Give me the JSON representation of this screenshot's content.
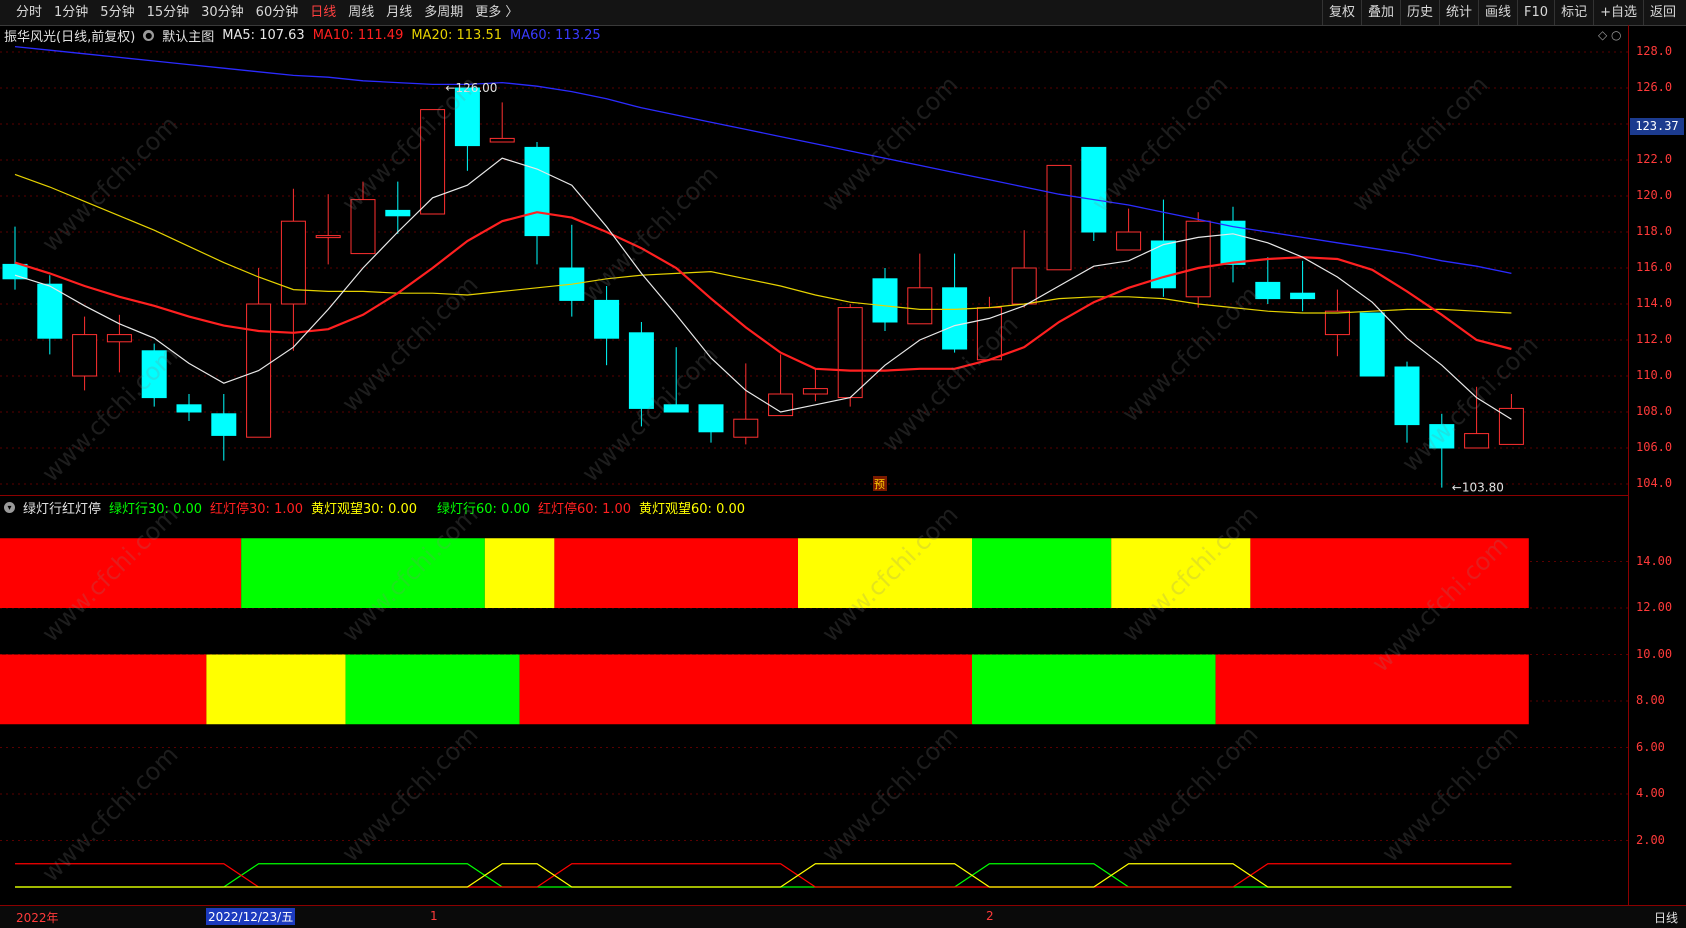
{
  "toolbar": {
    "periods": [
      "分时",
      "1分钟",
      "5分钟",
      "15分钟",
      "30分钟",
      "60分钟",
      "日线",
      "周线",
      "月线",
      "多周期",
      "更多 〉"
    ],
    "active_period": "日线",
    "right_tools": [
      "复权",
      "叠加",
      "历史",
      "统计",
      "画线",
      "F10",
      "标记",
      "+自选",
      "返回"
    ]
  },
  "main_info": {
    "stock": "振华风光(日线,前复权)",
    "template": "默认主图",
    "ma5": "MA5: 107.63",
    "ma10": "MA10: 111.49",
    "ma20": "MA20: 113.51",
    "ma60": "MA60: 113.25"
  },
  "sub_info": {
    "name": "绿灯行红灯停",
    "green30": "绿灯行30: 0.00",
    "red30": "红灯停30: 1.00",
    "yellow30": "黄灯观望30: 0.00",
    "green60": "绿灯行60: 0.00",
    "red60": "红灯停60: 1.00",
    "yellow60": "黄灯观望60: 0.00"
  },
  "annotations": {
    "high": "126.00",
    "low": "103.80",
    "forecast_mark": "预",
    "current_price": "123.37"
  },
  "price_axis": [
    "128.0",
    "126.0",
    "124.0",
    "122.0",
    "120.0",
    "118.0",
    "116.0",
    "114.0",
    "112.0",
    "110.0",
    "108.0",
    "106.0",
    "104.0"
  ],
  "sub_axis": [
    "14.00",
    "12.00",
    "10.00",
    "8.00",
    "6.00",
    "4.00",
    "2.00"
  ],
  "bottom": {
    "year": "2022年",
    "selected_date": "2022/12/23/五",
    "month1": "1",
    "month2": "2",
    "period": "日线"
  },
  "watermark": "www.cfchi.com",
  "colors": {
    "up": "#ff3030",
    "down": "#00ffff",
    "ma5": "#e8e8e8",
    "ma10": "#ff2020",
    "ma20": "#e6d200",
    "ma60": "#2b2bff",
    "signal_red": "#ff0000",
    "signal_green": "#00ff00",
    "signal_yellow": "#ffff00"
  },
  "chart_data": {
    "type": "candlestick",
    "y_range": [
      103.5,
      128.5
    ],
    "candles": [
      {
        "o": 116.2,
        "h": 118.3,
        "l": 114.8,
        "c": 115.4
      },
      {
        "o": 115.1,
        "h": 115.6,
        "l": 111.2,
        "c": 112.1
      },
      {
        "o": 110.0,
        "h": 113.3,
        "l": 109.2,
        "c": 112.3
      },
      {
        "o": 111.9,
        "h": 113.4,
        "l": 110.2,
        "c": 112.3
      },
      {
        "o": 111.4,
        "h": 111.8,
        "l": 108.3,
        "c": 108.8
      },
      {
        "o": 108.4,
        "h": 109.0,
        "l": 107.5,
        "c": 108.0
      },
      {
        "o": 107.9,
        "h": 109.0,
        "l": 105.3,
        "c": 106.7
      },
      {
        "o": 106.6,
        "h": 116.0,
        "l": 106.6,
        "c": 114.0
      },
      {
        "o": 114.0,
        "h": 120.4,
        "l": 111.4,
        "c": 118.6
      },
      {
        "o": 117.8,
        "h": 120.1,
        "l": 116.2,
        "c": 117.8
      },
      {
        "o": 116.8,
        "h": 120.8,
        "l": 116.8,
        "c": 119.8
      },
      {
        "o": 119.2,
        "h": 120.8,
        "l": 117.9,
        "c": 118.9
      },
      {
        "o": 119.0,
        "h": 122.0,
        "l": 119.0,
        "c": 124.8
      },
      {
        "o": 126.0,
        "h": 126.0,
        "l": 121.4,
        "c": 122.8
      },
      {
        "o": 123.0,
        "h": 125.2,
        "l": 123.0,
        "c": 123.2
      },
      {
        "o": 122.7,
        "h": 123.0,
        "l": 116.2,
        "c": 117.8
      },
      {
        "o": 116.0,
        "h": 118.4,
        "l": 113.3,
        "c": 114.2
      },
      {
        "o": 114.2,
        "h": 115.0,
        "l": 110.6,
        "c": 112.1
      },
      {
        "o": 112.4,
        "h": 113.0,
        "l": 107.2,
        "c": 108.2
      },
      {
        "o": 108.4,
        "h": 111.6,
        "l": 108.0,
        "c": 108.0
      },
      {
        "o": 108.4,
        "h": 108.4,
        "l": 106.3,
        "c": 106.9
      },
      {
        "o": 106.6,
        "h": 110.7,
        "l": 106.2,
        "c": 107.6
      },
      {
        "o": 107.8,
        "h": 111.2,
        "l": 107.8,
        "c": 109.0
      },
      {
        "o": 109.0,
        "h": 110.4,
        "l": 108.6,
        "c": 109.3
      },
      {
        "o": 108.8,
        "h": 114.0,
        "l": 108.3,
        "c": 113.8
      },
      {
        "o": 115.4,
        "h": 116.0,
        "l": 112.5,
        "c": 113.0
      },
      {
        "o": 112.9,
        "h": 116.8,
        "l": 112.9,
        "c": 114.9
      },
      {
        "o": 114.9,
        "h": 116.8,
        "l": 111.3,
        "c": 111.5
      },
      {
        "o": 110.9,
        "h": 114.4,
        "l": 110.9,
        "c": 113.8
      },
      {
        "o": 114.0,
        "h": 118.1,
        "l": 113.8,
        "c": 116.0
      },
      {
        "o": 115.9,
        "h": 121.7,
        "l": 115.9,
        "c": 121.7
      },
      {
        "o": 122.7,
        "h": 122.7,
        "l": 117.5,
        "c": 118.0
      },
      {
        "o": 117.0,
        "h": 119.3,
        "l": 117.0,
        "c": 118.0
      },
      {
        "o": 117.5,
        "h": 119.8,
        "l": 114.4,
        "c": 114.9
      },
      {
        "o": 114.4,
        "h": 119.1,
        "l": 113.8,
        "c": 118.6
      },
      {
        "o": 118.6,
        "h": 119.4,
        "l": 115.2,
        "c": 116.2
      },
      {
        "o": 115.2,
        "h": 116.6,
        "l": 114.0,
        "c": 114.3
      },
      {
        "o": 114.6,
        "h": 116.4,
        "l": 113.6,
        "c": 114.3
      },
      {
        "o": 112.3,
        "h": 114.8,
        "l": 111.1,
        "c": 113.6
      },
      {
        "o": 113.5,
        "h": 113.5,
        "l": 110.0,
        "c": 110.0
      },
      {
        "o": 110.5,
        "h": 110.8,
        "l": 106.3,
        "c": 107.3
      },
      {
        "o": 107.3,
        "h": 107.9,
        "l": 103.8,
        "c": 106.0
      },
      {
        "o": 106.0,
        "h": 109.4,
        "l": 106.0,
        "c": 106.8
      },
      {
        "o": 106.2,
        "h": 109.0,
        "l": 106.2,
        "c": 108.2
      }
    ],
    "ma5": [
      115.6,
      115.0,
      113.9,
      112.9,
      112.1,
      110.7,
      109.6,
      110.3,
      111.6,
      113.7,
      116.0,
      118.0,
      119.9,
      120.6,
      122.1,
      121.5,
      120.6,
      118.3,
      115.7,
      113.4,
      111.0,
      109.2,
      108.0,
      108.4,
      108.8,
      110.6,
      112.0,
      112.8,
      113.2,
      113.9,
      115.0,
      116.1,
      116.4,
      117.3,
      117.7,
      117.9,
      117.4,
      116.6,
      115.5,
      114.1,
      112.1,
      110.6,
      108.8,
      107.6
    ],
    "ma10": [
      116.3,
      115.7,
      115.0,
      114.4,
      113.9,
      113.3,
      112.8,
      112.5,
      112.4,
      112.6,
      113.4,
      114.6,
      116.0,
      117.5,
      118.6,
      119.1,
      118.8,
      118.0,
      117.1,
      116.0,
      114.3,
      112.7,
      111.3,
      110.4,
      110.3,
      110.3,
      110.4,
      110.4,
      110.9,
      111.6,
      113.0,
      114.1,
      114.9,
      115.5,
      116.0,
      116.3,
      116.5,
      116.6,
      116.5,
      115.9,
      114.7,
      113.4,
      112.0,
      111.5
    ],
    "ma20": [
      121.2,
      120.5,
      119.7,
      118.9,
      118.1,
      117.2,
      116.3,
      115.5,
      114.8,
      114.7,
      114.7,
      114.6,
      114.6,
      114.5,
      114.7,
      114.9,
      115.1,
      115.4,
      115.6,
      115.7,
      115.8,
      115.4,
      115.0,
      114.5,
      114.1,
      113.9,
      113.7,
      113.7,
      113.8,
      114.0,
      114.3,
      114.4,
      114.4,
      114.3,
      114.0,
      113.8,
      113.6,
      113.5,
      113.5,
      113.6,
      113.7,
      113.7,
      113.6,
      113.5
    ],
    "ma60": [
      128.3,
      128.1,
      127.9,
      127.7,
      127.5,
      127.3,
      127.1,
      126.9,
      126.7,
      126.6,
      126.4,
      126.3,
      126.2,
      126.2,
      126.3,
      126.1,
      125.8,
      125.4,
      124.9,
      124.5,
      124.1,
      123.7,
      123.3,
      122.9,
      122.5,
      122.1,
      121.7,
      121.3,
      120.9,
      120.5,
      120.1,
      119.8,
      119.5,
      119.1,
      118.7,
      118.3,
      118.0,
      117.7,
      117.4,
      117.1,
      116.8,
      116.4,
      116.1,
      115.7
    ]
  },
  "signal_bars": {
    "band30": [
      {
        "from": 0,
        "to": 7,
        "color": "red"
      },
      {
        "from": 7,
        "to": 14,
        "color": "green"
      },
      {
        "from": 14,
        "to": 16,
        "color": "yellow"
      },
      {
        "from": 16,
        "to": 23,
        "color": "red"
      },
      {
        "from": 23,
        "to": 28,
        "color": "yellow"
      },
      {
        "from": 28,
        "to": 32,
        "color": "green"
      },
      {
        "from": 32,
        "to": 36,
        "color": "yellow"
      },
      {
        "from": 36,
        "to": 44,
        "color": "red"
      }
    ],
    "band60": [
      {
        "from": 0,
        "to": 6,
        "color": "red"
      },
      {
        "from": 6,
        "to": 10,
        "color": "yellow"
      },
      {
        "from": 10,
        "to": 15,
        "color": "green"
      },
      {
        "from": 15,
        "to": 28,
        "color": "red"
      },
      {
        "from": 28,
        "to": 35,
        "color": "green"
      },
      {
        "from": 35,
        "to": 44,
        "color": "red"
      }
    ]
  }
}
